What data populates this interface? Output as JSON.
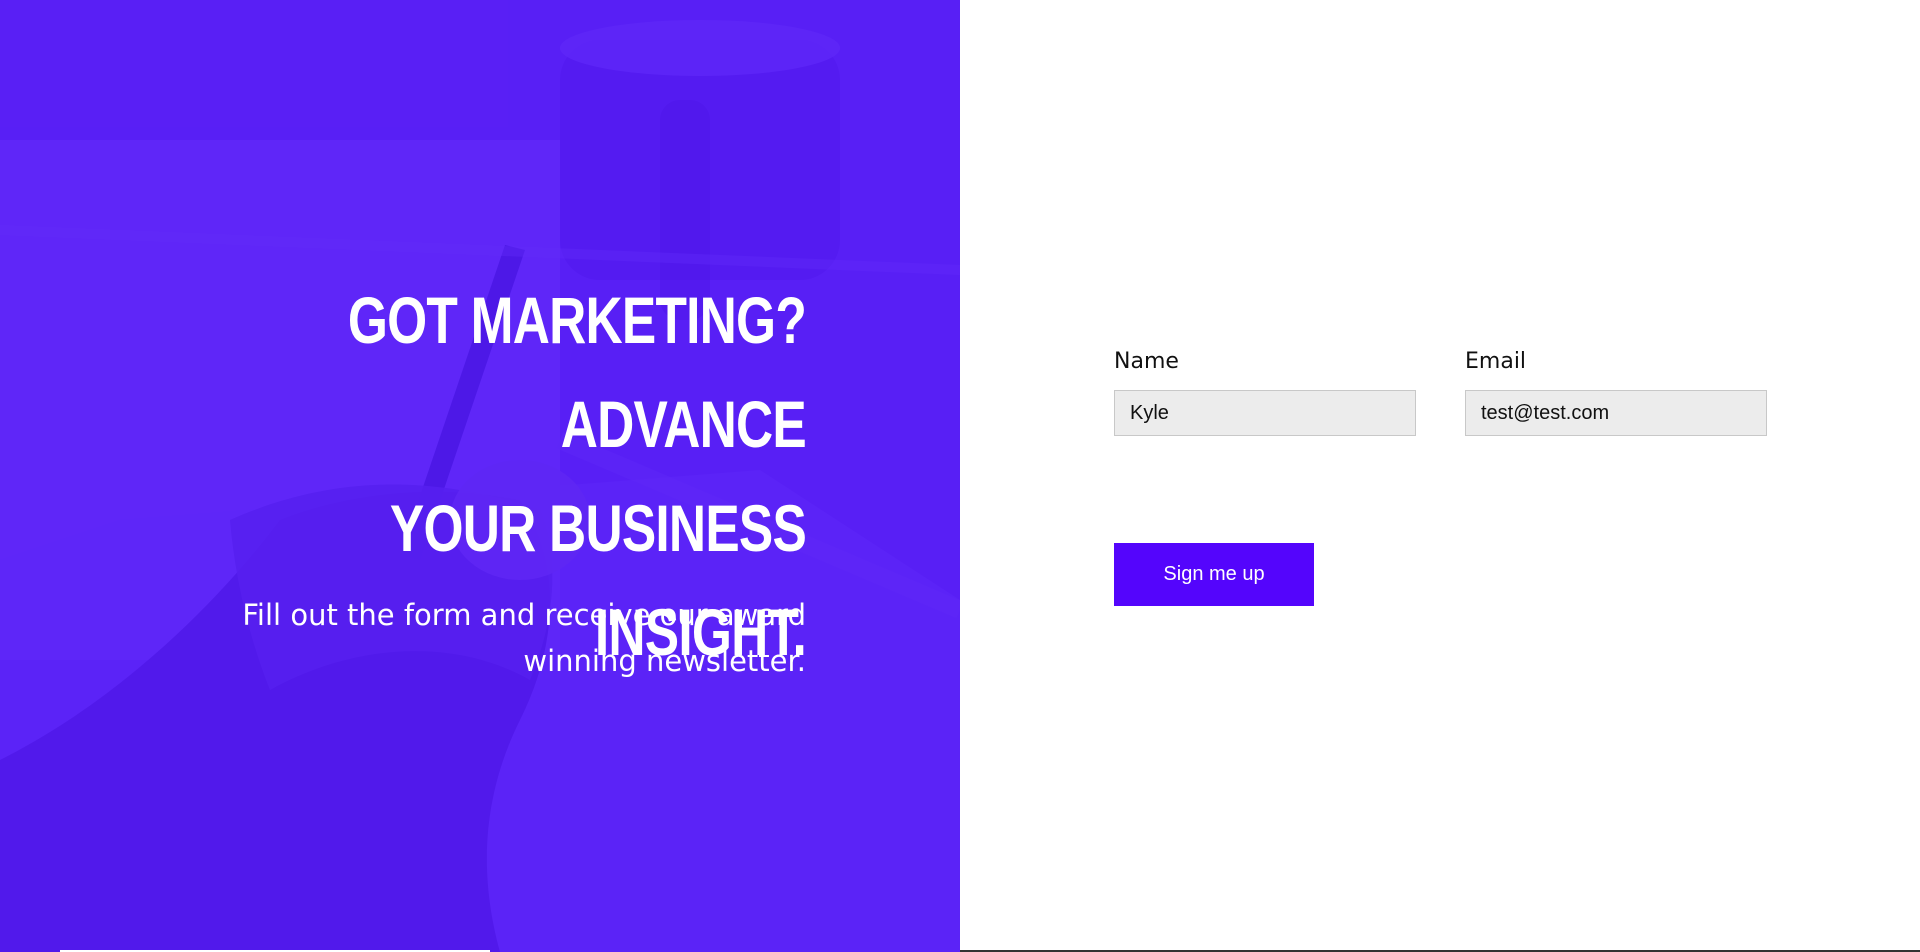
{
  "hero": {
    "heading_line1": "Got marketing? Advance",
    "heading_line2": "your business insight.",
    "subtext": "Fill out the form and receive our award winning newsletter.",
    "accent_color": "#5405fc"
  },
  "form": {
    "name": {
      "label": "Name",
      "value": "Kyle"
    },
    "email": {
      "label": "Email",
      "value": "test@test.com"
    },
    "submit_label": "Sign me up"
  }
}
